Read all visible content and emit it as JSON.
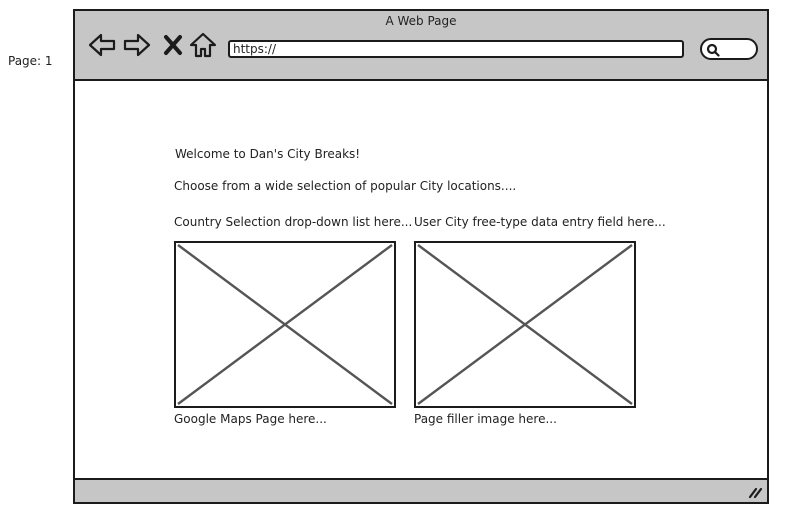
{
  "page": {
    "label": "Page: 1"
  },
  "browser": {
    "title": "A Web Page",
    "url": "https://",
    "nav_icons": [
      "back-arrow-icon",
      "forward-arrow-icon",
      "stop-x-icon",
      "home-icon"
    ],
    "search_icon": "search-icon"
  },
  "content": {
    "welcome": "Welcome to Dan's City Breaks!",
    "intro": "Choose from a wide selection of popular City locations....",
    "country_label": "Country Selection drop-down list here...",
    "city_label": "User City free-type data entry field here...",
    "left_image_caption": "Google Maps Page here...",
    "right_image_caption": "Page filler image here..."
  },
  "colors": {
    "chrome": "#c6c6c6",
    "stroke": "#1b1b1b",
    "placeholder_cross": "#555555"
  }
}
